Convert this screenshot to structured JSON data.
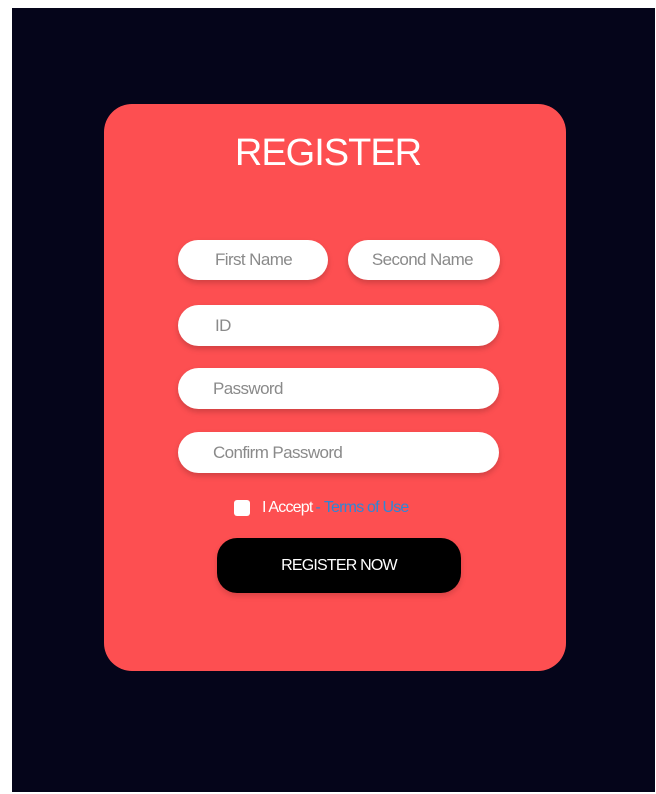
{
  "colors": {
    "page_background": "#05051a",
    "card_background": "#fd4f51",
    "field_background": "#ffffff",
    "button_background": "#000000",
    "link_color": "#2f86d6"
  },
  "form": {
    "title": "REGISTER",
    "fields": {
      "first_name": {
        "placeholder": "First Name",
        "value": ""
      },
      "second_name": {
        "placeholder": "Second Name",
        "value": ""
      },
      "id": {
        "placeholder": "ID",
        "value": ""
      },
      "password": {
        "placeholder": "Password",
        "value": ""
      },
      "confirm_password": {
        "placeholder": "Confirm Password",
        "value": ""
      }
    },
    "accept": {
      "checked": false,
      "label": "I Accept",
      "separator": "-",
      "terms_link": "Terms of Use"
    },
    "submit_label": "REGISTER NOW"
  }
}
